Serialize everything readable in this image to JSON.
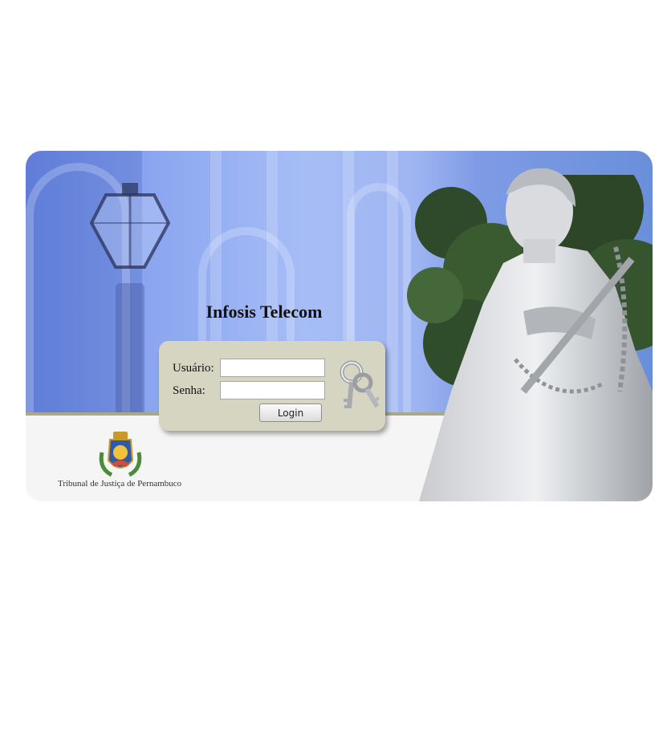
{
  "app": {
    "title": "Infosis Telecom",
    "organization": "Tribunal de Justiça de Pernambuco"
  },
  "login": {
    "username_label": "Usuário:",
    "username_value": "",
    "password_label": "Senha:",
    "password_value": "",
    "submit_label": "Login"
  },
  "icons": {
    "keys": "keys-icon",
    "crest": "coat-of-arms-icon"
  },
  "colors": {
    "login_panel": "#d6d5c1",
    "band_line": "#a9a98a",
    "photo_blue": "#8ba6f0"
  }
}
